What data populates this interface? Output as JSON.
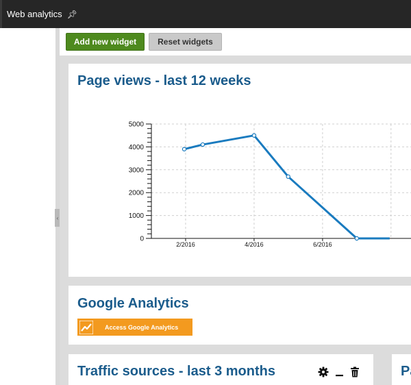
{
  "topbar": {
    "title": "Web analytics",
    "pin_icon": "pin-icon"
  },
  "toolbar": {
    "add_label": "Add new widget",
    "reset_label": "Reset widgets"
  },
  "widgets": {
    "page_views": {
      "title": "Page views - last 12 weeks"
    },
    "google_analytics": {
      "title": "Google Analytics",
      "button_label": "Access Google Analytics",
      "icon": "analytics-icon"
    },
    "traffic_sources": {
      "title": "Traffic sources - last 3 months",
      "controls": [
        "gear-icon",
        "minimize-icon",
        "trash-icon"
      ]
    },
    "partial": {
      "title": "Pa"
    }
  },
  "colors": {
    "accent": "#1b5c8c",
    "add_button": "#4e8a1e",
    "ga_button": "#f39a1f",
    "series": "#1a7bbf"
  },
  "chart_data": {
    "type": "line",
    "title": "Page views - last 12 weeks",
    "x_labels": [
      "2/2016",
      "4/2016",
      "6/2016"
    ],
    "x": [
      2016.08,
      2016.125,
      2016.25,
      2016.333,
      2016.5,
      2016.58
    ],
    "xlim": [
      2016.0,
      2016.667
    ],
    "series": [
      {
        "values": [
          3900,
          4100,
          4500,
          2700,
          0,
          0
        ]
      }
    ],
    "ylim": [
      0,
      5000
    ],
    "y_ticks": [
      0,
      1000,
      2000,
      3000,
      4000,
      5000
    ],
    "grid": true
  }
}
